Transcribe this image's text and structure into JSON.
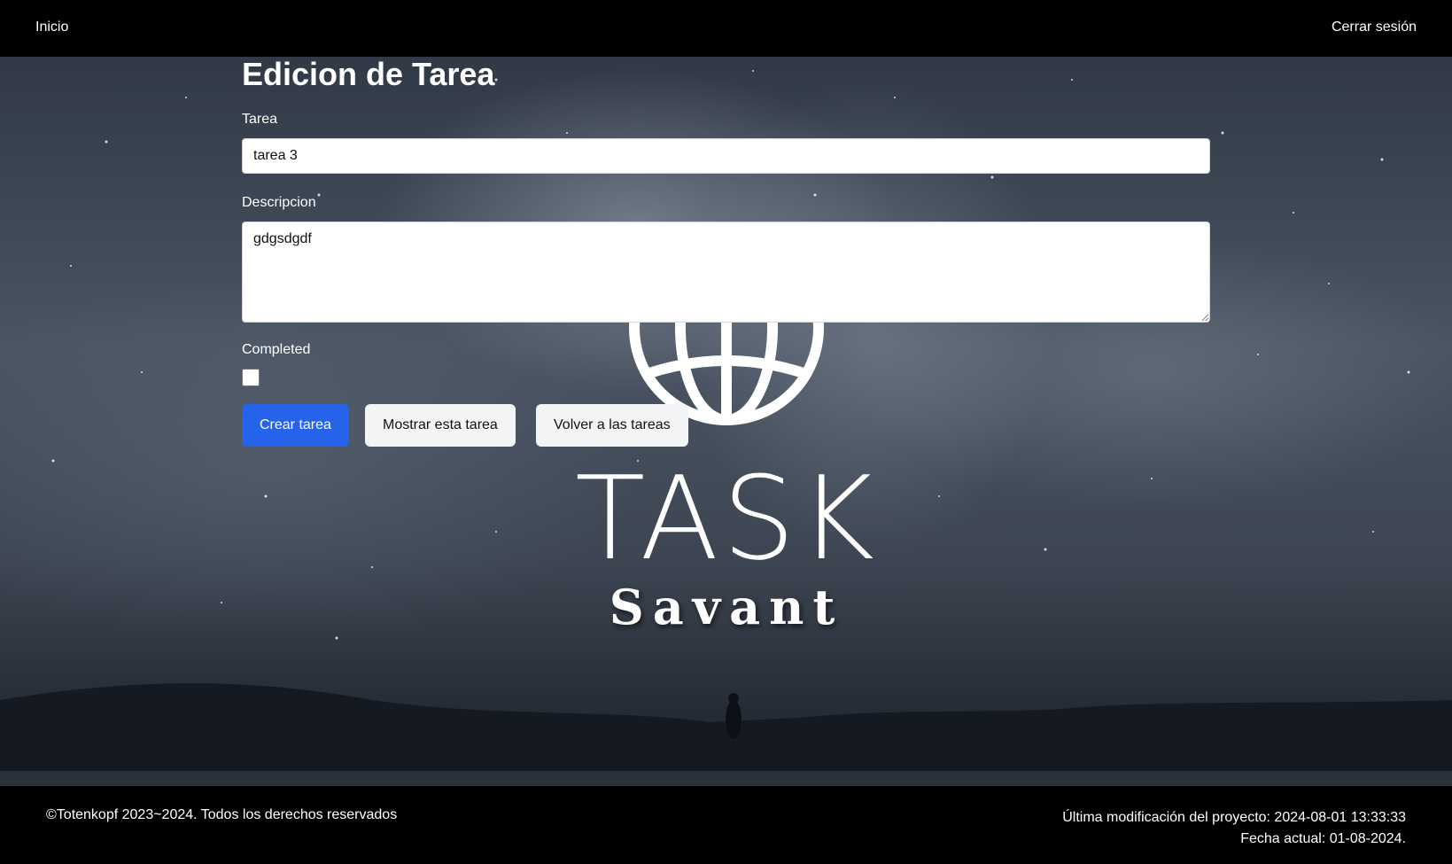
{
  "nav": {
    "home_label": "Inicio",
    "logout_label": "Cerrar sesión"
  },
  "logo": {
    "title": "TASK",
    "subtitle": "Savant"
  },
  "form": {
    "heading": "Edicion de Tarea",
    "task_label": "Tarea",
    "task_value": "tarea 3",
    "description_label": "Descripcion",
    "description_value": "gdgsdgdf",
    "completed_label": "Completed",
    "completed_checked": false,
    "buttons": {
      "create": "Crear tarea",
      "show": "Mostrar esta tarea",
      "back": "Volver a las tareas"
    }
  },
  "footer": {
    "copyright": "©Totenkopf 2023~2024. Todos los derechos reservados",
    "last_modified": "Última modificación del proyecto: 2024-08-01 13:33:33",
    "current_date": "Fecha actual: 01-08-2024."
  },
  "colors": {
    "primary_button": "#2563eb",
    "nav_background": "#000000"
  }
}
